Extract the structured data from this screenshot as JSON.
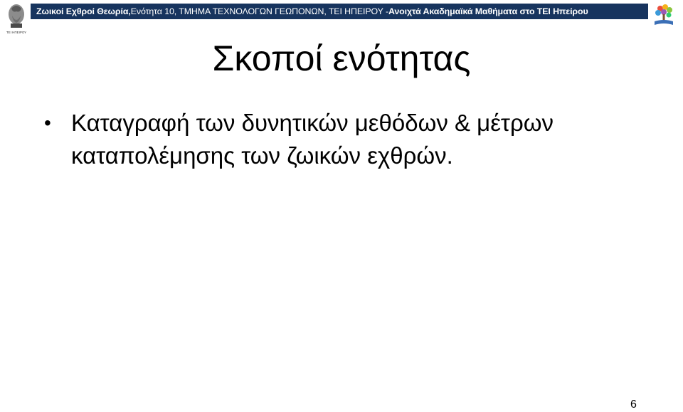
{
  "header": {
    "course": "Ζωικοί Εχθροί Θεωρία,",
    "section": " Ενότητα 10, ΤΜΗΜΑ ΤΕΧΝΟΛΟΓΩΝ ΓΕΩΠΟΝΩΝ, ΤΕΙ ΗΠΕΙΡΟΥ - ",
    "program": "Ανοιχτά Ακαδημαϊκά Μαθήματα στο ΤΕΙ Ηπείρου",
    "left_logo_caption": "ΤΕΙ ΗΠΕΙΡΟΥ",
    "left_logo_icon": "tei-epirus-logo-icon",
    "right_logo_icon": "open-courses-logo-icon",
    "bar_color": "#17345e"
  },
  "slide": {
    "title": "Σκοποί ενότητας",
    "bullets": [
      "Καταγραφή των δυνητικών μεθόδων & μέτρων καταπολέμησης των ζωικών εχθρών."
    ],
    "bullet_symbol": "•",
    "page_number": "6"
  }
}
